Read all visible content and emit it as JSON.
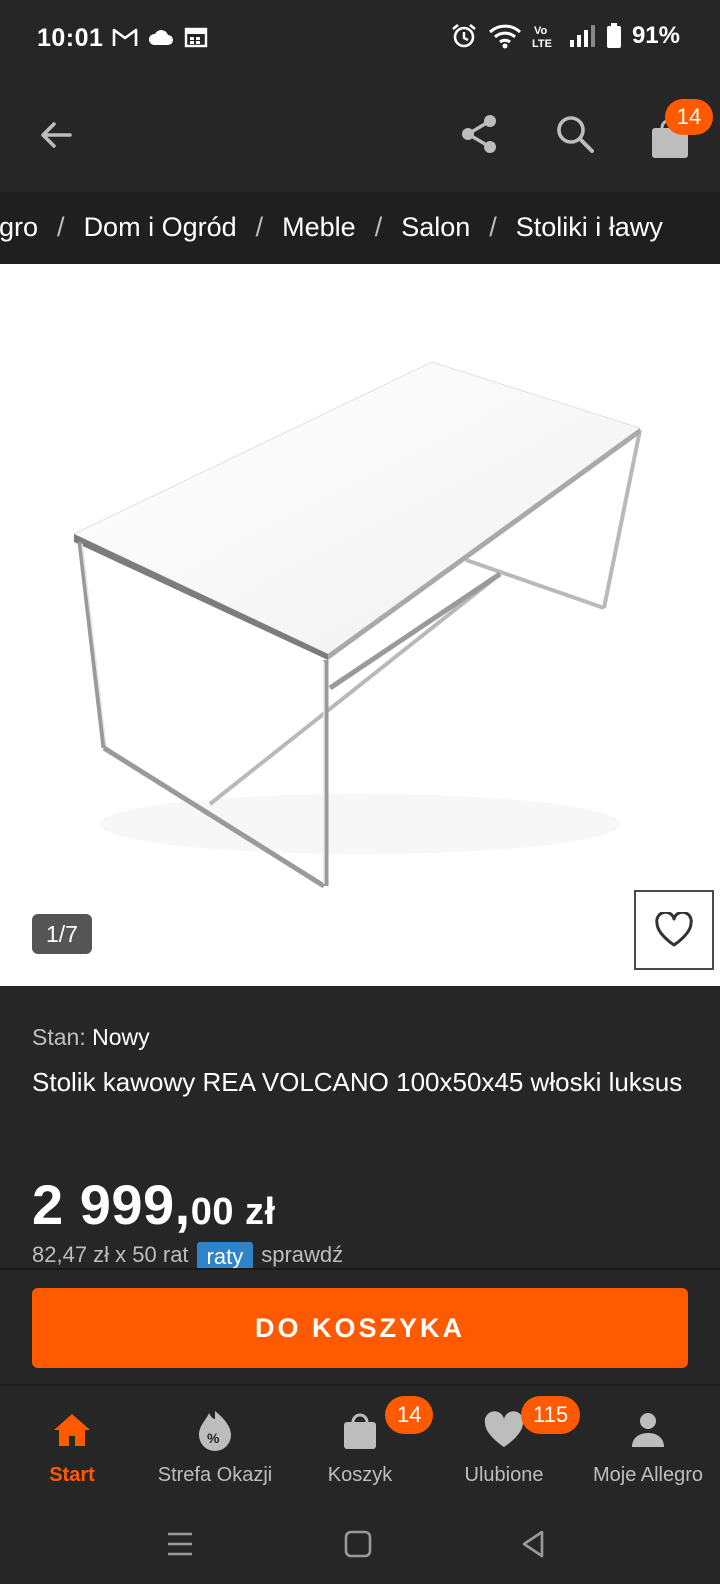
{
  "status_bar": {
    "time": "10:01",
    "battery": "91%",
    "left_icons": [
      "gmail-icon",
      "cloud-icon",
      "calendar-icon"
    ],
    "right_icons": [
      "alarm-icon",
      "wifi-icon",
      "volte-icon",
      "signal-icon",
      "battery-icon"
    ]
  },
  "app_bar": {
    "cart_count": "14"
  },
  "breadcrumb": {
    "items": [
      "Allegro",
      "Dom i Ogród",
      "Meble",
      "Salon",
      "Stoliki i ławy"
    ]
  },
  "gallery": {
    "counter": "1/7"
  },
  "product": {
    "condition_label": "Stan:",
    "condition_value": "Nowy",
    "title": "Stolik kawowy REA VOLCANO 100x50x45 włoski luksus",
    "price_main": "2 999,",
    "price_decimals": "00 zł",
    "installment_text": "82,47 zł x 50 rat",
    "installment_badge": "raty",
    "installment_link": "sprawdź"
  },
  "cta": {
    "label": "DO KOSZYKA"
  },
  "bottom_nav": {
    "items": [
      {
        "label": "Start",
        "icon": "home-icon"
      },
      {
        "label": "Strefa Okazji",
        "icon": "deals-icon"
      },
      {
        "label": "Koszyk",
        "icon": "bag-icon",
        "badge": "14"
      },
      {
        "label": "Ulubione",
        "icon": "heart-icon",
        "badge": "115"
      },
      {
        "label": "Moje Allegro",
        "icon": "person-icon"
      }
    ]
  },
  "colors": {
    "accent": "#ff5a00",
    "background": "#262626",
    "raty_badge": "#2f84c9"
  }
}
